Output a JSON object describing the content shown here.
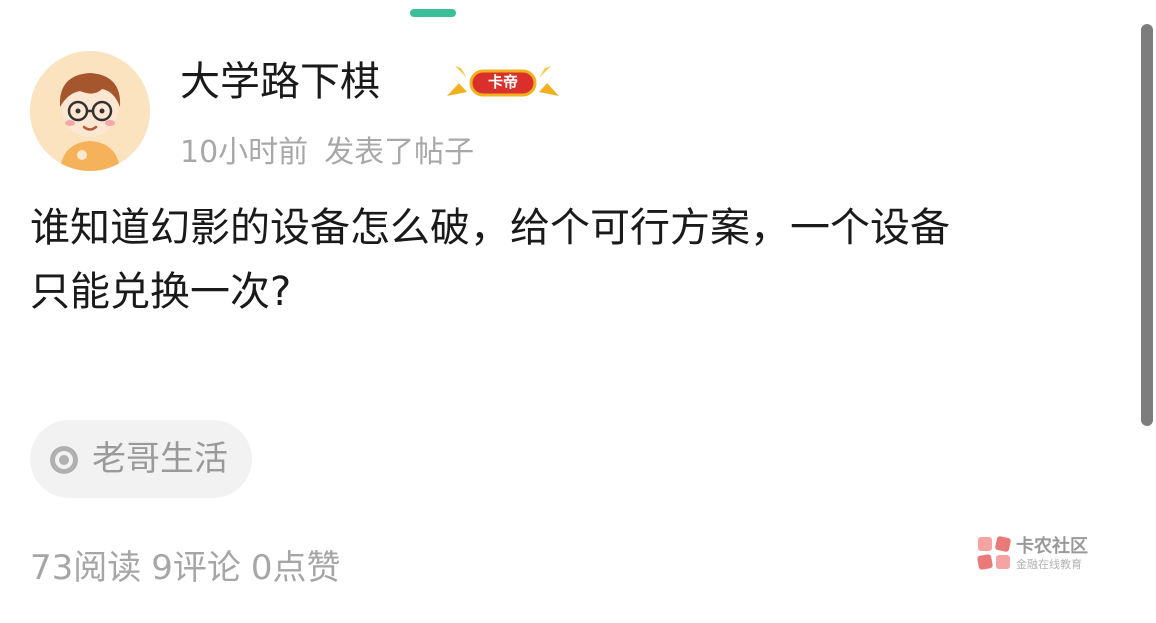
{
  "post": {
    "author": "大学路下棋",
    "badge": "卡帝",
    "time": "10小时前",
    "action": "发表了帖子",
    "content_line1": "谁知道幻影的设备怎么破，给个可行方案，一个设备",
    "content_line2": "只能兑换一次?",
    "tag": "老哥生活",
    "tag_icon": "circle-target-icon"
  },
  "stats": {
    "reads": "73阅读",
    "comments": "9评论",
    "likes": "0点赞"
  },
  "watermark": {
    "name": "卡农社区",
    "subtitle": "金融在线教育"
  },
  "colors": {
    "accent": "#3bbf98",
    "text": "#1a1a1a",
    "muted": "#a8a8a8",
    "tag_bg": "#f2f2f2",
    "badge_red": "#d9302b",
    "badge_gold": "#f2b01e"
  }
}
